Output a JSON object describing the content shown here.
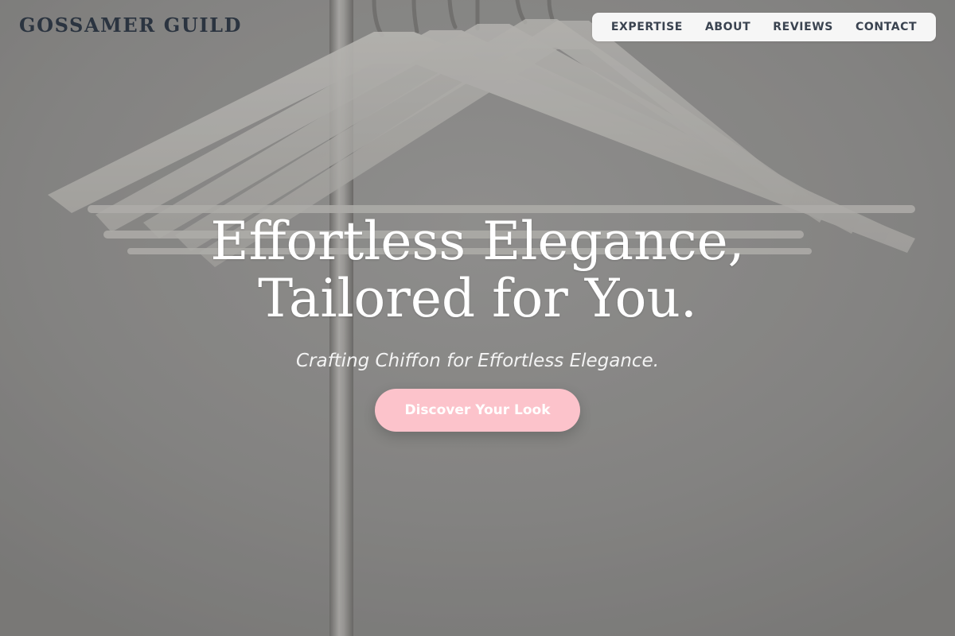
{
  "brand": {
    "name": "GOSSAMER GUILD"
  },
  "nav": {
    "items": [
      {
        "label": "EXPERTISE"
      },
      {
        "label": "ABOUT"
      },
      {
        "label": "REVIEWS"
      },
      {
        "label": "CONTACT"
      }
    ]
  },
  "hero": {
    "headline_line1": "Effortless Elegance,",
    "headline_line2": "Tailored for You.",
    "subtitle": "Crafting Chiffon for Effortless Elegance.",
    "cta_label": "Discover Your Look",
    "background": "white clothes hangers on metal rack",
    "colors": {
      "brand_text": "#2b3440",
      "nav_bg": "#f6f6f6",
      "cta_bg": "#fcc3cb",
      "headline_text": "#ffffff"
    }
  }
}
